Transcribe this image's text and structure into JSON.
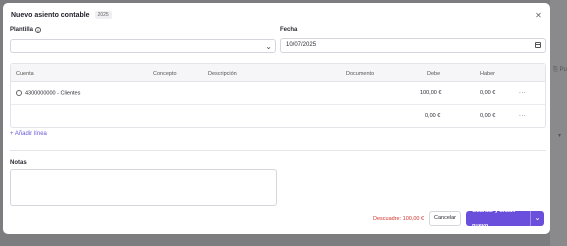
{
  "modal": {
    "title": "Nuevo asiento contable",
    "year_badge": "2025",
    "close_icon": "close-icon"
  },
  "fields": {
    "template_label": "Plantilla",
    "template_value": "",
    "date_label": "Fecha",
    "date_value": "10/07/2025"
  },
  "table": {
    "headers": [
      "Cuenta",
      "Concepto",
      "Descripción",
      "Documento",
      "Debe",
      "Haber"
    ],
    "rows": [
      {
        "account": "4300000000 - Clientes",
        "concept": "",
        "description": "",
        "document": "",
        "debit": "100,00 €",
        "credit": "0,00 €",
        "menu": "···"
      },
      {
        "account": "",
        "concept": "",
        "description": "",
        "document": "",
        "debit": "0,00 €",
        "credit": "0,00 €",
        "menu": "···"
      }
    ]
  },
  "add_line_label": "+ Añadir línea",
  "notes": {
    "label": "Notas",
    "value": ""
  },
  "footer": {
    "imbalance_text": "Descuadre: 100,00 €",
    "cancel_label": "Cancelar",
    "save_label": "Guardar y añadir nuevo"
  },
  "colors": {
    "accent": "#6a4fdc",
    "error": "#d0342c"
  }
}
